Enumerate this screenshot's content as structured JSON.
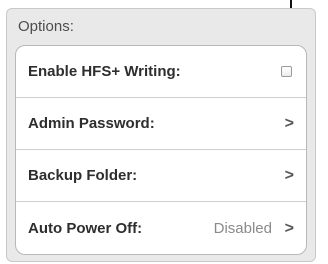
{
  "options": {
    "title": "Options:",
    "items": [
      {
        "label": "Enable HFS+ Writing:",
        "control": "checkbox",
        "checked": false
      },
      {
        "label": "Admin Password:",
        "control": "chevron",
        "chevron": ">"
      },
      {
        "label": "Backup Folder:",
        "control": "chevron",
        "chevron": ">"
      },
      {
        "label": "Auto Power Off:",
        "value": "Disabled",
        "control": "chevron",
        "chevron": ">"
      }
    ]
  },
  "annotation": {
    "icon": "down-arrow-icon"
  }
}
